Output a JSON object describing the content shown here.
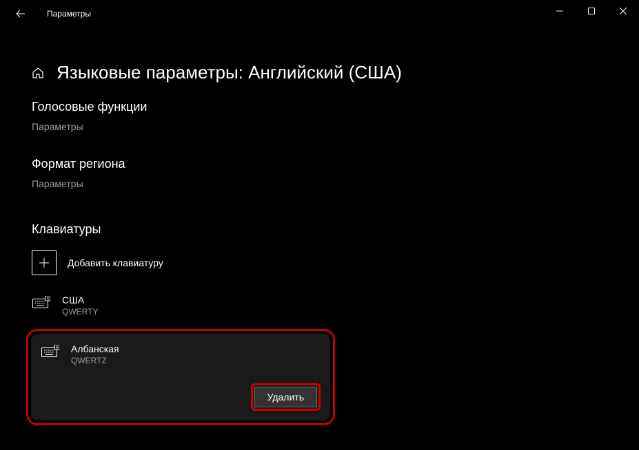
{
  "titlebar": {
    "app_title": "Параметры"
  },
  "page": {
    "title": "Языковые параметры: Английский (США)"
  },
  "sections": {
    "voice": {
      "title": "Голосовые функции",
      "link": "Параметры"
    },
    "region": {
      "title": "Формат региона",
      "link": "Параметры"
    },
    "keyboards": {
      "title": "Клавиатуры",
      "add_label": "Добавить клавиатуру",
      "items": [
        {
          "name": "США",
          "layout": "QWERTY"
        },
        {
          "name": "Албанская",
          "layout": "QWERTZ"
        }
      ]
    }
  },
  "buttons": {
    "delete": "Удалить"
  }
}
